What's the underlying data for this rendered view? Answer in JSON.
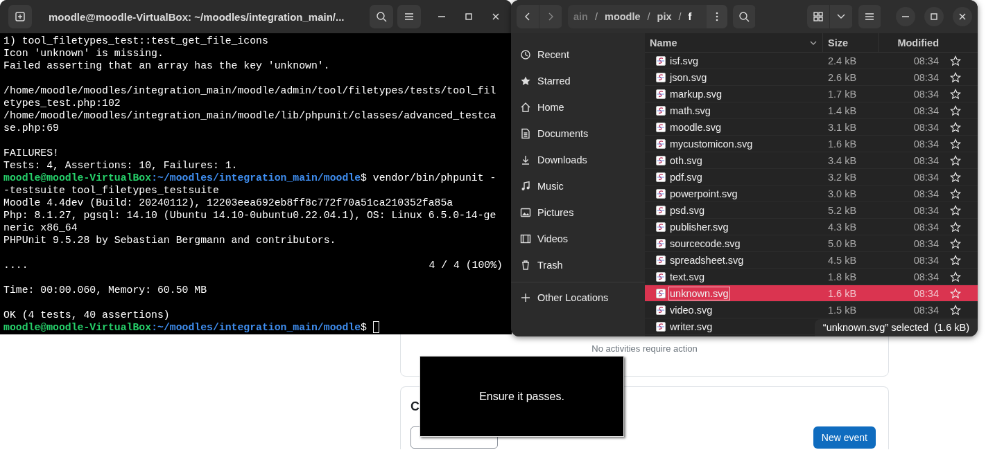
{
  "page": {
    "notice": "No activities require action",
    "card_heading": "C",
    "new_event_button": "New event"
  },
  "caption": "Ensure it passes.",
  "terminal": {
    "title": "moodle@moodle-VirtualBox: ~/moodles/integration_main/...",
    "lines": [
      {
        "kind": "text",
        "text": "1) tool_filetypes_test::test_get_file_icons"
      },
      {
        "kind": "text",
        "text": "Icon 'unknown' is missing."
      },
      {
        "kind": "text",
        "text": "Failed asserting that an array has the key 'unknown'."
      },
      {
        "kind": "blank"
      },
      {
        "kind": "text",
        "text": "/home/moodle/moodles/integration_main/moodle/admin/tool/filetypes/tests/tool_fil"
      },
      {
        "kind": "text",
        "text": "etypes_test.php:102"
      },
      {
        "kind": "text",
        "text": "/home/moodle/moodles/integration_main/moodle/lib/phpunit/classes/advanced_testca"
      },
      {
        "kind": "text",
        "text": "se.php:69"
      },
      {
        "kind": "blank"
      },
      {
        "kind": "text",
        "text": "FAILURES!"
      },
      {
        "kind": "text",
        "text": "Tests: 4, Assertions: 10, Failures: 1."
      },
      {
        "kind": "prompt",
        "user": "moodle@moodle-VirtualBox",
        "path": ":~/moodles/integration_main/moodle",
        "command": "$ vendor/bin/phpunit -"
      },
      {
        "kind": "text",
        "text": "-testsuite tool_filetypes_testsuite"
      },
      {
        "kind": "text",
        "text": "Moodle 4.4dev (Build: 20240112), 12203eea692eb8ff8c772f70a51ca210352fa85a"
      },
      {
        "kind": "text",
        "text": "Php: 8.1.27, pgsql: 14.10 (Ubuntu 14.10-0ubuntu0.22.04.1), OS: Linux 6.5.0-14-ge"
      },
      {
        "kind": "text",
        "text": "neric x86_64"
      },
      {
        "kind": "text",
        "text": "PHPUnit 9.5.28 by Sebastian Bergmann and contributors."
      },
      {
        "kind": "blank"
      },
      {
        "kind": "progress",
        "text": "....",
        "count": "4 / 4 (100%)"
      },
      {
        "kind": "blank"
      },
      {
        "kind": "text",
        "text": "Time: 00:00.060, Memory: 60.50 MB"
      },
      {
        "kind": "blank"
      },
      {
        "kind": "text",
        "text": "OK (4 tests, 40 assertions)"
      },
      {
        "kind": "prompt",
        "user": "moodle@moodle-VirtualBox",
        "path": ":~/moodles/integration_main/moodle",
        "command": "$ ",
        "cursor": true
      }
    ]
  },
  "file_manager": {
    "path": [
      "ain",
      "/",
      "moodle",
      "/",
      "pix",
      "/",
      "f"
    ],
    "sidebar": [
      {
        "kind": "recent",
        "label": "Recent"
      },
      {
        "kind": "starred",
        "label": "Starred"
      },
      {
        "kind": "home",
        "label": "Home"
      },
      {
        "kind": "documents",
        "label": "Documents"
      },
      {
        "kind": "downloads",
        "label": "Downloads"
      },
      {
        "kind": "music",
        "label": "Music"
      },
      {
        "kind": "pictures",
        "label": "Pictures"
      },
      {
        "kind": "videos",
        "label": "Videos"
      },
      {
        "kind": "trash",
        "label": "Trash"
      },
      {
        "kind": "other",
        "label": "Other Locations"
      }
    ],
    "columns": [
      "Name",
      "Size",
      "Modified"
    ],
    "files": [
      {
        "name": "isf.svg",
        "size": "2.4 kB",
        "modified": "08:34",
        "selected": false,
        "starred": false
      },
      {
        "name": "json.svg",
        "size": "2.6 kB",
        "modified": "08:34",
        "selected": false,
        "starred": false
      },
      {
        "name": "markup.svg",
        "size": "1.7 kB",
        "modified": "08:34",
        "selected": false,
        "starred": false
      },
      {
        "name": "math.svg",
        "size": "1.4 kB",
        "modified": "08:34",
        "selected": false,
        "starred": false
      },
      {
        "name": "moodle.svg",
        "size": "3.1 kB",
        "modified": "08:34",
        "selected": false,
        "starred": false
      },
      {
        "name": "mycustomicon.svg",
        "size": "1.6 kB",
        "modified": "08:34",
        "selected": false,
        "starred": false
      },
      {
        "name": "oth.svg",
        "size": "3.4 kB",
        "modified": "08:34",
        "selected": false,
        "starred": false
      },
      {
        "name": "pdf.svg",
        "size": "3.2 kB",
        "modified": "08:34",
        "selected": false,
        "starred": false
      },
      {
        "name": "powerpoint.svg",
        "size": "3.0 kB",
        "modified": "08:34",
        "selected": false,
        "starred": false
      },
      {
        "name": "psd.svg",
        "size": "5.2 kB",
        "modified": "08:34",
        "selected": false,
        "starred": false
      },
      {
        "name": "publisher.svg",
        "size": "4.3 kB",
        "modified": "08:34",
        "selected": false,
        "starred": false
      },
      {
        "name": "sourcecode.svg",
        "size": "5.0 kB",
        "modified": "08:34",
        "selected": false,
        "starred": false
      },
      {
        "name": "spreadsheet.svg",
        "size": "4.5 kB",
        "modified": "08:34",
        "selected": false,
        "starred": false
      },
      {
        "name": "text.svg",
        "size": "1.8 kB",
        "modified": "08:34",
        "selected": false,
        "starred": false
      },
      {
        "name": "unknown.svg",
        "size": "1.6 kB",
        "modified": "08:34",
        "selected": true,
        "starred": false
      },
      {
        "name": "video.svg",
        "size": "1.5 kB",
        "modified": "08:34",
        "selected": false,
        "starred": false
      },
      {
        "name": "writer.svg",
        "selected": false
      }
    ],
    "status": "“unknown.svg” selected  (1.6 kB)"
  }
}
